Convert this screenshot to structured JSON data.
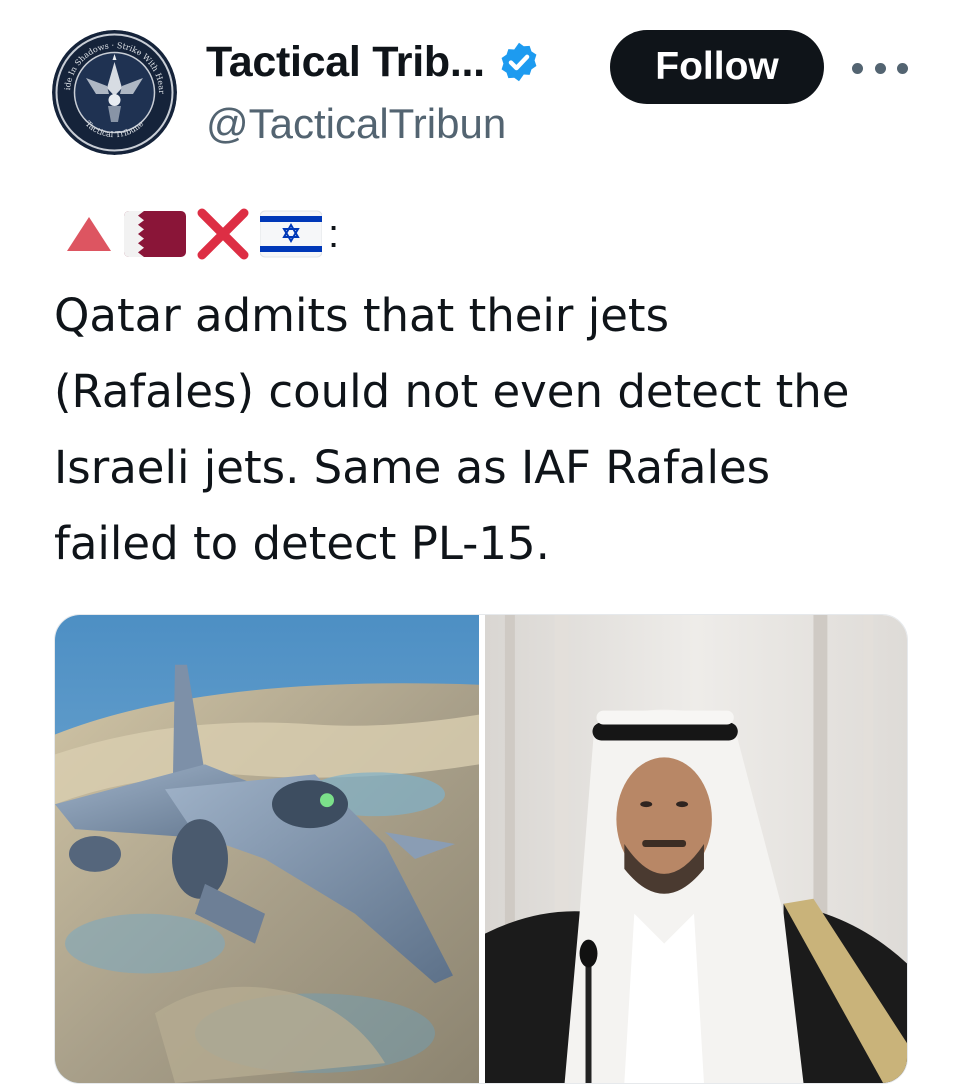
{
  "author": {
    "display_name": "Tactical Trib...",
    "handle": "@TacticalTribun",
    "verified": true,
    "avatar_icon": "circular-emblem-logo",
    "avatar_ring_top_text": "Hide In Shadows · Strike With Heart",
    "avatar_ring_bottom_text": "Tactical Tribune"
  },
  "actions": {
    "follow_label": "Follow",
    "more_icon": "more-horizontal-icon"
  },
  "tweet": {
    "emoji_prefix": [
      "red-triangle-up-emoji",
      "qatar-flag-emoji",
      "cross-mark-emoji",
      "israel-flag-emoji"
    ],
    "emoji_suffix": ":",
    "lines": [
      "Qatar admits that their jets",
      "(Rafales) could not even detect the",
      "Israeli jets. Same as IAF Rafales",
      "failed to detect PL-15."
    ]
  },
  "media": [
    {
      "icon": "fighter-jet-photo"
    },
    {
      "icon": "portrait-photo"
    }
  ],
  "colors": {
    "text_primary": "#0f1419",
    "text_secondary": "#536471",
    "verified_blue": "#1d9bf0",
    "follow_bg": "#0f1419",
    "qatar_maroon": "#8a1538",
    "israel_blue": "#0038b8",
    "cross_red": "#dd2e44"
  }
}
